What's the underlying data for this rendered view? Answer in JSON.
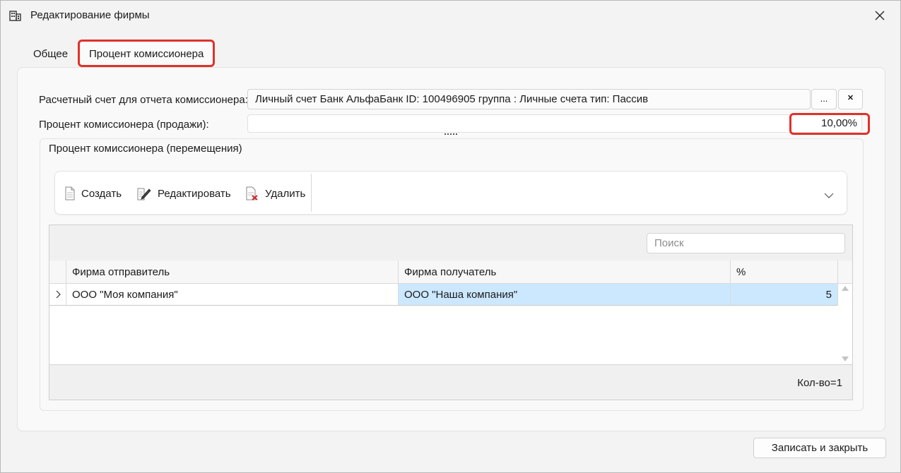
{
  "window": {
    "title": "Редактирование фирмы",
    "close_glyph": "✕"
  },
  "tabs": [
    {
      "label": "Общее"
    },
    {
      "label": "Процент комиссионера",
      "active": true
    }
  ],
  "form": {
    "account_label": "Расчетный счет для отчета комиссионера:",
    "account_value": "Личный счет Банк АльфаБанк ID: 100496905 группа : Личные счета тип: Пассив",
    "browse_button": "...",
    "clear_button": "✕",
    "percent_sales_label": "Процент комиссионера (продажи):",
    "percent_sales_value": "10,00%"
  },
  "group": {
    "title": "Процент комиссионера (перемещения)",
    "toolbar": {
      "create": "Создать",
      "edit": "Редактировать",
      "delete": "Удалить"
    },
    "search_placeholder": "Поиск",
    "columns": [
      "Фирма отправитель",
      "Фирма получатель",
      "%"
    ],
    "rows": [
      {
        "sender": "ООО \"Моя компания\"",
        "receiver": "ООО \"Наша компания\"",
        "percent": "5"
      }
    ],
    "count": "Кол-во=1"
  },
  "footer": {
    "save_close": "Записать и закрыть"
  },
  "colors": {
    "highlight": "#e0312a",
    "selected_row": "#cce8ff"
  }
}
